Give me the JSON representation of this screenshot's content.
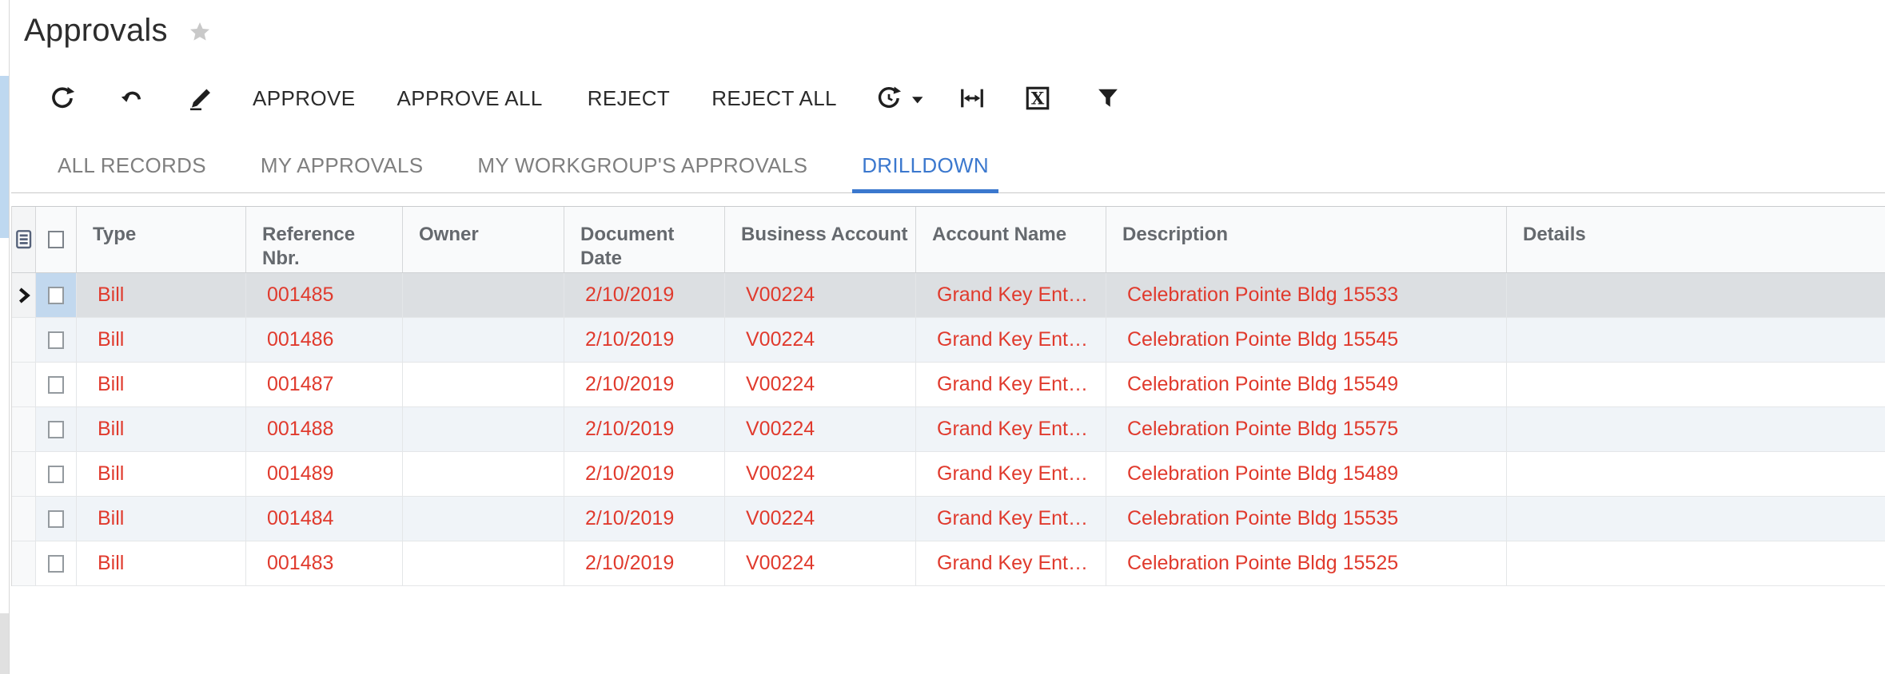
{
  "page": {
    "title": "Approvals"
  },
  "toolbar": {
    "icons_left": [
      "refresh-icon",
      "undo-icon",
      "edit-icon"
    ],
    "buttons": {
      "approve": "APPROVE",
      "approve_all": "APPROVE ALL",
      "reject": "REJECT",
      "reject_all": "REJECT ALL"
    },
    "icons_right": [
      "schedule-refresh-icon",
      "dropdown-caret-icon",
      "fit-width-icon",
      "export-excel-icon",
      "filter-icon"
    ]
  },
  "tabs": [
    {
      "label": "ALL RECORDS",
      "active": false
    },
    {
      "label": "MY APPROVALS",
      "active": false
    },
    {
      "label": "MY WORKGROUP'S APPROVALS",
      "active": false
    },
    {
      "label": "DRILLDOWN",
      "active": true
    }
  ],
  "grid": {
    "columns": [
      "Type",
      "Reference Nbr.",
      "Owner",
      "Document Date",
      "Business Account",
      "Account Name",
      "Description",
      "Details"
    ],
    "rows": [
      {
        "selected": true,
        "type": "Bill",
        "reference_nbr": "001485",
        "owner": "",
        "document_date": "2/10/2019",
        "business_account": "V00224",
        "account_name": "Grand Key Ent…",
        "description": "Celebration Pointe Bldg 15533",
        "details": ""
      },
      {
        "selected": false,
        "type": "Bill",
        "reference_nbr": "001486",
        "owner": "",
        "document_date": "2/10/2019",
        "business_account": "V00224",
        "account_name": "Grand Key Ent…",
        "description": "Celebration Pointe Bldg 15545",
        "details": ""
      },
      {
        "selected": false,
        "type": "Bill",
        "reference_nbr": "001487",
        "owner": "",
        "document_date": "2/10/2019",
        "business_account": "V00224",
        "account_name": "Grand Key Ent…",
        "description": "Celebration Pointe Bldg 15549",
        "details": ""
      },
      {
        "selected": false,
        "type": "Bill",
        "reference_nbr": "001488",
        "owner": "",
        "document_date": "2/10/2019",
        "business_account": "V00224",
        "account_name": "Grand Key Ent…",
        "description": "Celebration Pointe Bldg 15575",
        "details": ""
      },
      {
        "selected": false,
        "type": "Bill",
        "reference_nbr": "001489",
        "owner": "",
        "document_date": "2/10/2019",
        "business_account": "V00224",
        "account_name": "Grand Key Ent…",
        "description": "Celebration Pointe Bldg 15489",
        "details": ""
      },
      {
        "selected": false,
        "type": "Bill",
        "reference_nbr": "001484",
        "owner": "",
        "document_date": "2/10/2019",
        "business_account": "V00224",
        "account_name": "Grand Key Ent…",
        "description": "Celebration Pointe Bldg 15535",
        "details": ""
      },
      {
        "selected": false,
        "type": "Bill",
        "reference_nbr": "001483",
        "owner": "",
        "document_date": "2/10/2019",
        "business_account": "V00224",
        "account_name": "Grand Key Ent…",
        "description": "Celebration Pointe Bldg 15525",
        "details": ""
      }
    ]
  },
  "colors": {
    "accent_blue": "#3b78ce",
    "record_red": "#e03a2d",
    "selected_row": "#dcdfe2",
    "selected_cell": "#c2d8ee",
    "alt_row": "#f0f4f8",
    "star_gray": "#c9c9c9"
  }
}
